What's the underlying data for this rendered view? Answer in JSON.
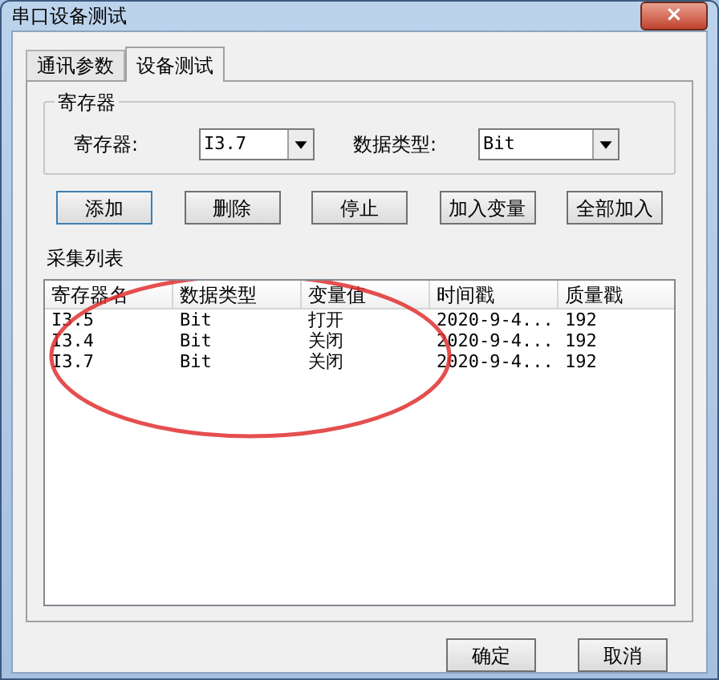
{
  "window": {
    "title": "串口设备测试",
    "close": "×"
  },
  "tabs": [
    {
      "label": "通讯参数",
      "selected": false
    },
    {
      "label": "设备测试",
      "selected": true
    }
  ],
  "register_group": {
    "title": "寄存器",
    "register_label": "寄存器:",
    "register_value": "I3.7",
    "data_type_label": "数据类型:",
    "data_type_value": "Bit"
  },
  "buttons": [
    "添加",
    "删除",
    "停止",
    "加入变量",
    "全部加入"
  ],
  "list": {
    "title": "采集列表",
    "columns": [
      "寄存器名",
      "数据类型",
      "变量值",
      "时间戳",
      "质量戳"
    ],
    "rows": [
      [
        "I3.5",
        "Bit",
        "打开",
        "2020-9-4...",
        "192"
      ],
      [
        "I3.4",
        "Bit",
        "关闭",
        "2020-9-4...",
        "192"
      ],
      [
        "I3.7",
        "Bit",
        "关闭",
        "2020-9-4...",
        "192"
      ]
    ]
  },
  "footer_buttons": [
    "确定",
    "取消"
  ]
}
